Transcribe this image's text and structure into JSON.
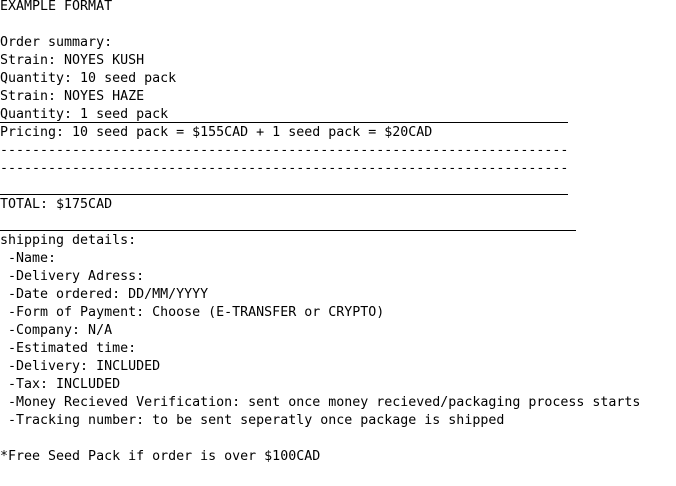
{
  "header": {
    "title": "EXAMPLE FORMAT"
  },
  "order": {
    "heading": "Order summary:",
    "items": [
      {
        "strain": "Strain: NOYES KUSH",
        "quantity": "Quantity: 10 seed pack"
      },
      {
        "strain": "Strain: NOYES HAZE",
        "quantity": "Quantity: 1 seed pack"
      }
    ]
  },
  "pricing": {
    "line": "Pricing: 10 seed pack = $155CAD + 1 seed pack = $20CAD",
    "dash_line_1": "-----------------------------------------------------------------------",
    "dash_line_2": "-----------------------------------------------------------------------"
  },
  "total": {
    "line": "TOTAL: $175CAD"
  },
  "shipping": {
    "heading": "shipping details:",
    "fields": [
      " -Name:",
      " -Delivery Adress:",
      " -Date ordered: DD/MM/YYYY",
      " -Form of Payment: Choose (E-TRANSFER or CRYPTO)",
      " -Company: N/A",
      " -Estimated time:",
      " -Delivery: INCLUDED",
      " -Tax: INCLUDED",
      " -Money Recieved Verification: sent once money recieved/packaging process starts",
      " -Tracking number: to be sent seperatly once package is shipped"
    ]
  },
  "footer": {
    "note": "*Free Seed Pack if order is over $100CAD"
  }
}
